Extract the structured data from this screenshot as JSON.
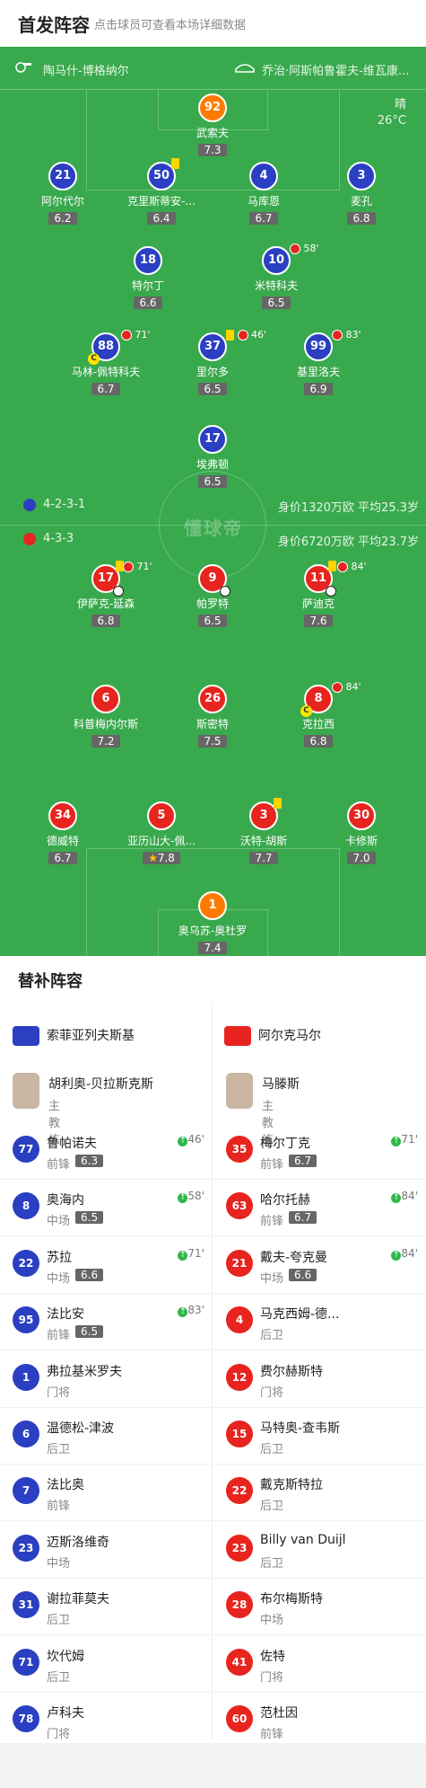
{
  "header": {
    "title": "首发阵容",
    "subtitle": "点击球员可查看本场详细数据"
  },
  "teams": {
    "home": "陶马什-博格纳尔",
    "away": "乔治·阿斯帕鲁霍夫-维瓦康..."
  },
  "weather": {
    "condition": "晴",
    "temp": "26°C"
  },
  "watermark": "懂球帝",
  "home_info": {
    "formation": "4-2-3-1",
    "stats": "身价1320万欧 平均25.3岁"
  },
  "away_info": {
    "formation": "4-3-3",
    "stats": "身价6720万欧 平均23.7岁"
  },
  "home_players": [
    {
      "num": "92",
      "name": "武索夫",
      "rating": "7.3"
    },
    {
      "num": "21",
      "name": "阿尔代尔",
      "rating": "6.2"
    },
    {
      "num": "50",
      "name": "克里斯蒂安-...",
      "rating": "6.4"
    },
    {
      "num": "4",
      "name": "马库恩",
      "rating": "6.7"
    },
    {
      "num": "3",
      "name": "麦孔",
      "rating": "6.8"
    },
    {
      "num": "18",
      "name": "特尔丁",
      "rating": "6.6"
    },
    {
      "num": "10",
      "name": "米特科夫",
      "rating": "6.5",
      "event": "58'"
    },
    {
      "num": "88",
      "name": "马林-佩特科夫",
      "rating": "6.7",
      "event": "71'",
      "captain": "C"
    },
    {
      "num": "37",
      "name": "里尔多",
      "rating": "6.5",
      "event": "46'"
    },
    {
      "num": "99",
      "name": "基里洛夫",
      "rating": "6.9",
      "event": "83'"
    },
    {
      "num": "17",
      "name": "埃弗顿",
      "rating": "6.5"
    }
  ],
  "away_players": [
    {
      "num": "17",
      "name": "伊萨克-延森",
      "rating": "6.8",
      "event": "71'"
    },
    {
      "num": "9",
      "name": "帕罗特",
      "rating": "6.5"
    },
    {
      "num": "11",
      "name": "萨迪克",
      "rating": "7.6",
      "event": "84'"
    },
    {
      "num": "6",
      "name": "科普梅内尔斯",
      "rating": "7.2"
    },
    {
      "num": "26",
      "name": "斯密特",
      "rating": "7.5"
    },
    {
      "num": "8",
      "name": "克拉西",
      "rating": "6.8",
      "event": "84'",
      "captain": "C"
    },
    {
      "num": "34",
      "name": "德威特",
      "rating": "6.7"
    },
    {
      "num": "5",
      "name": "亚历山大-佩...",
      "rating": "7.8"
    },
    {
      "num": "3",
      "name": "沃特-胡斯",
      "rating": "7.7"
    },
    {
      "num": "30",
      "name": "卡修斯",
      "rating": "7.0"
    },
    {
      "num": "1",
      "name": "奥乌苏-奥杜罗",
      "rating": "7.4"
    }
  ],
  "subs": {
    "title": "替补阵容",
    "home_team": "索菲亚列夫斯基",
    "away_team": "阿尔克马尔",
    "home_coach": {
      "name": "胡利奥-贝拉斯克斯",
      "role": "主教练"
    },
    "away_coach": {
      "name": "马滕斯",
      "role": "主教练"
    },
    "home": [
      {
        "num": "77",
        "name": "鲁帕诺夫",
        "pos": "前锋",
        "rating": "6.3",
        "in": "46'"
      },
      {
        "num": "8",
        "name": "奥海内",
        "pos": "中场",
        "rating": "6.5",
        "in": "58'"
      },
      {
        "num": "22",
        "name": "苏拉",
        "pos": "中场",
        "rating": "6.6",
        "in": "71'"
      },
      {
        "num": "95",
        "name": "法比安",
        "pos": "前锋",
        "rating": "6.5",
        "in": "83'"
      },
      {
        "num": "1",
        "name": "弗拉基米罗夫",
        "pos": "门将"
      },
      {
        "num": "6",
        "name": "温德松-津波",
        "pos": "后卫"
      },
      {
        "num": "7",
        "name": "法比奥",
        "pos": "前锋"
      },
      {
        "num": "23",
        "name": "迈斯洛维奇",
        "pos": "中场"
      },
      {
        "num": "31",
        "name": "谢拉菲莫夫",
        "pos": "后卫"
      },
      {
        "num": "71",
        "name": "坎代姆",
        "pos": "后卫"
      },
      {
        "num": "78",
        "name": "卢科夫",
        "pos": "门将"
      }
    ],
    "away": [
      {
        "num": "35",
        "name": "梅尔丁克",
        "pos": "前锋",
        "rating": "6.7",
        "in": "71'"
      },
      {
        "num": "63",
        "name": "哈尔托赫",
        "pos": "前锋",
        "rating": "6.7",
        "in": "84'"
      },
      {
        "num": "21",
        "name": "戴夫-夸克曼",
        "pos": "中场",
        "rating": "6.6",
        "in": "84'"
      },
      {
        "num": "4",
        "name": "马克西姆-德...",
        "pos": "后卫"
      },
      {
        "num": "12",
        "name": "费尔赫斯特",
        "pos": "门将"
      },
      {
        "num": "15",
        "name": "马特奥-查韦斯",
        "pos": "后卫"
      },
      {
        "num": "22",
        "name": "戴克斯特拉",
        "pos": "后卫"
      },
      {
        "num": "23",
        "name": "Billy van Duijl",
        "pos": "后卫"
      },
      {
        "num": "28",
        "name": "布尔梅斯特",
        "pos": "中场"
      },
      {
        "num": "41",
        "name": "佐特",
        "pos": "门将"
      },
      {
        "num": "60",
        "name": "范杜因",
        "pos": "前锋"
      }
    ]
  },
  "colors": {
    "pitch": "#39a94d",
    "home": "#2a3fc2",
    "away": "#e8241f",
    "keeper_home": "#ff7a00"
  }
}
